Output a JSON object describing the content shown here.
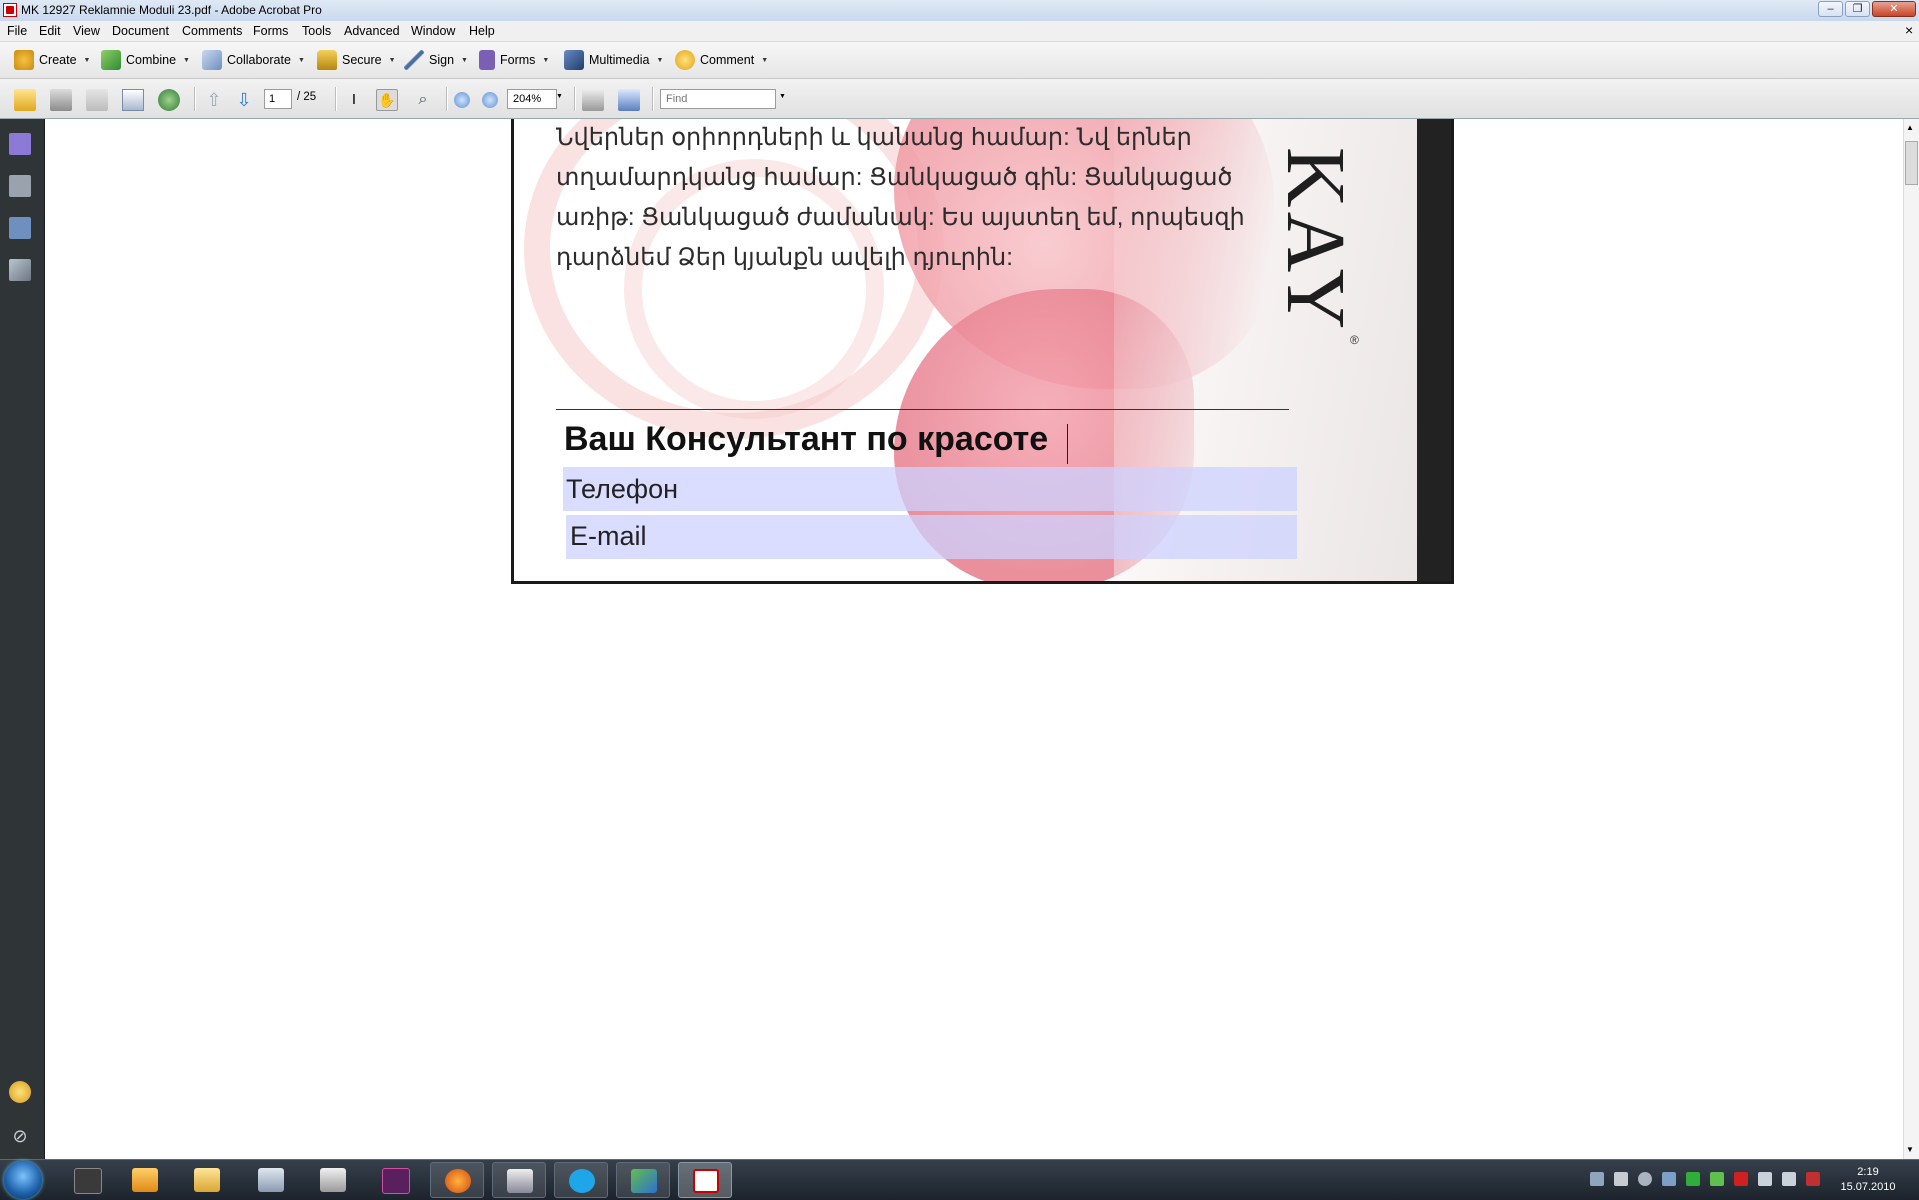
{
  "window": {
    "title": "MK 12927 Reklamnie Moduli 23.pdf - Adobe Acrobat Pro",
    "minimize": "–",
    "restore": "❐",
    "close": "✕",
    "doc_close": "×"
  },
  "menu": [
    "File",
    "Edit",
    "View",
    "Document",
    "Comments",
    "Forms",
    "Tools",
    "Advanced",
    "Window",
    "Help"
  ],
  "tasks": [
    {
      "label": "Create",
      "icon": "create-icon"
    },
    {
      "label": "Combine",
      "icon": "combine-icon"
    },
    {
      "label": "Collaborate",
      "icon": "collaborate-icon"
    },
    {
      "label": "Secure",
      "icon": "lock-icon"
    },
    {
      "label": "Sign",
      "icon": "pen-icon"
    },
    {
      "label": "Forms",
      "icon": "forms-icon"
    },
    {
      "label": "Multimedia",
      "icon": "multimedia-icon"
    },
    {
      "label": "Comment",
      "icon": "comment-icon"
    }
  ],
  "toolbar": {
    "page_current": "1",
    "page_total": "/ 25",
    "zoom": "204%",
    "find_placeholder": "Find"
  },
  "document": {
    "armenian_lines": [
      "Նվերներ օրիորդների և կանանց  համար: Նվ երներ",
      "տղամարդկանց համար: Ցանկացած գին:  Ցանկացած",
      "առիթ: Ցանկացած ժամանակ: Ես այստեղ եմ,  որպեսզի",
      "դարձնեմ Ձեր կյանքն ավելի դյուրին:"
    ],
    "brand_text": "KAY",
    "brand_mark": "®",
    "consultant_heading": "Ваш Консультант по красоте",
    "phone_label": "Телефон",
    "email_label": "E-mail"
  },
  "clock": {
    "time": "2:19",
    "date": "15.07.2010"
  },
  "colors": {
    "nav_panel": "#2f3437",
    "form_highlight": "#cdd2ff",
    "ribbon_pink": "#f2a3ad"
  }
}
